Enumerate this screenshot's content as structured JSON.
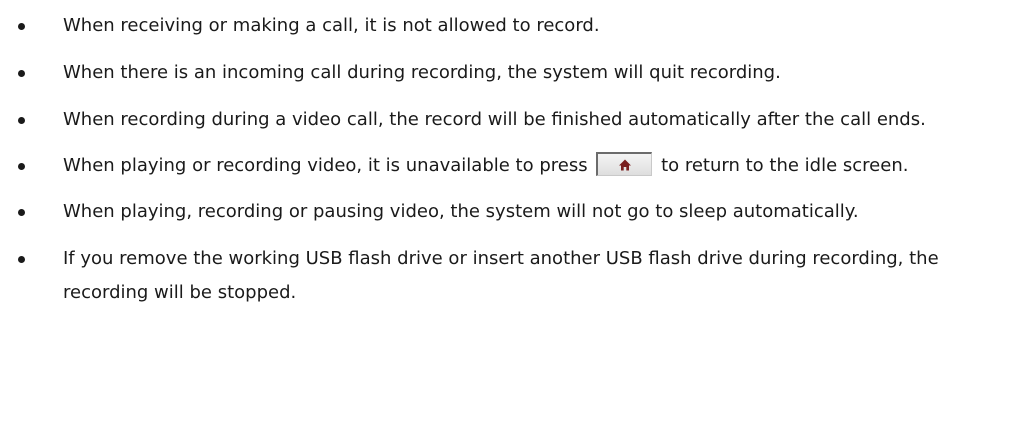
{
  "notes": [
    {
      "text": "When receiving or making a call, it is not allowed to record."
    },
    {
      "text": "When there is an incoming call during recording, the system will quit recording."
    },
    {
      "text": "When recording during a video call, the record will be finished automatically after the call ends."
    },
    {
      "text_before": "When playing or recording video, it is unavailable to press",
      "icon": "home-icon",
      "text_after": "to return to the idle screen."
    },
    {
      "text": "When playing, recording or pausing video, the system will not go to sleep automatically."
    },
    {
      "text": "If you remove the working USB flash drive or insert another USB flash drive during recording, the recording will be stopped."
    }
  ]
}
